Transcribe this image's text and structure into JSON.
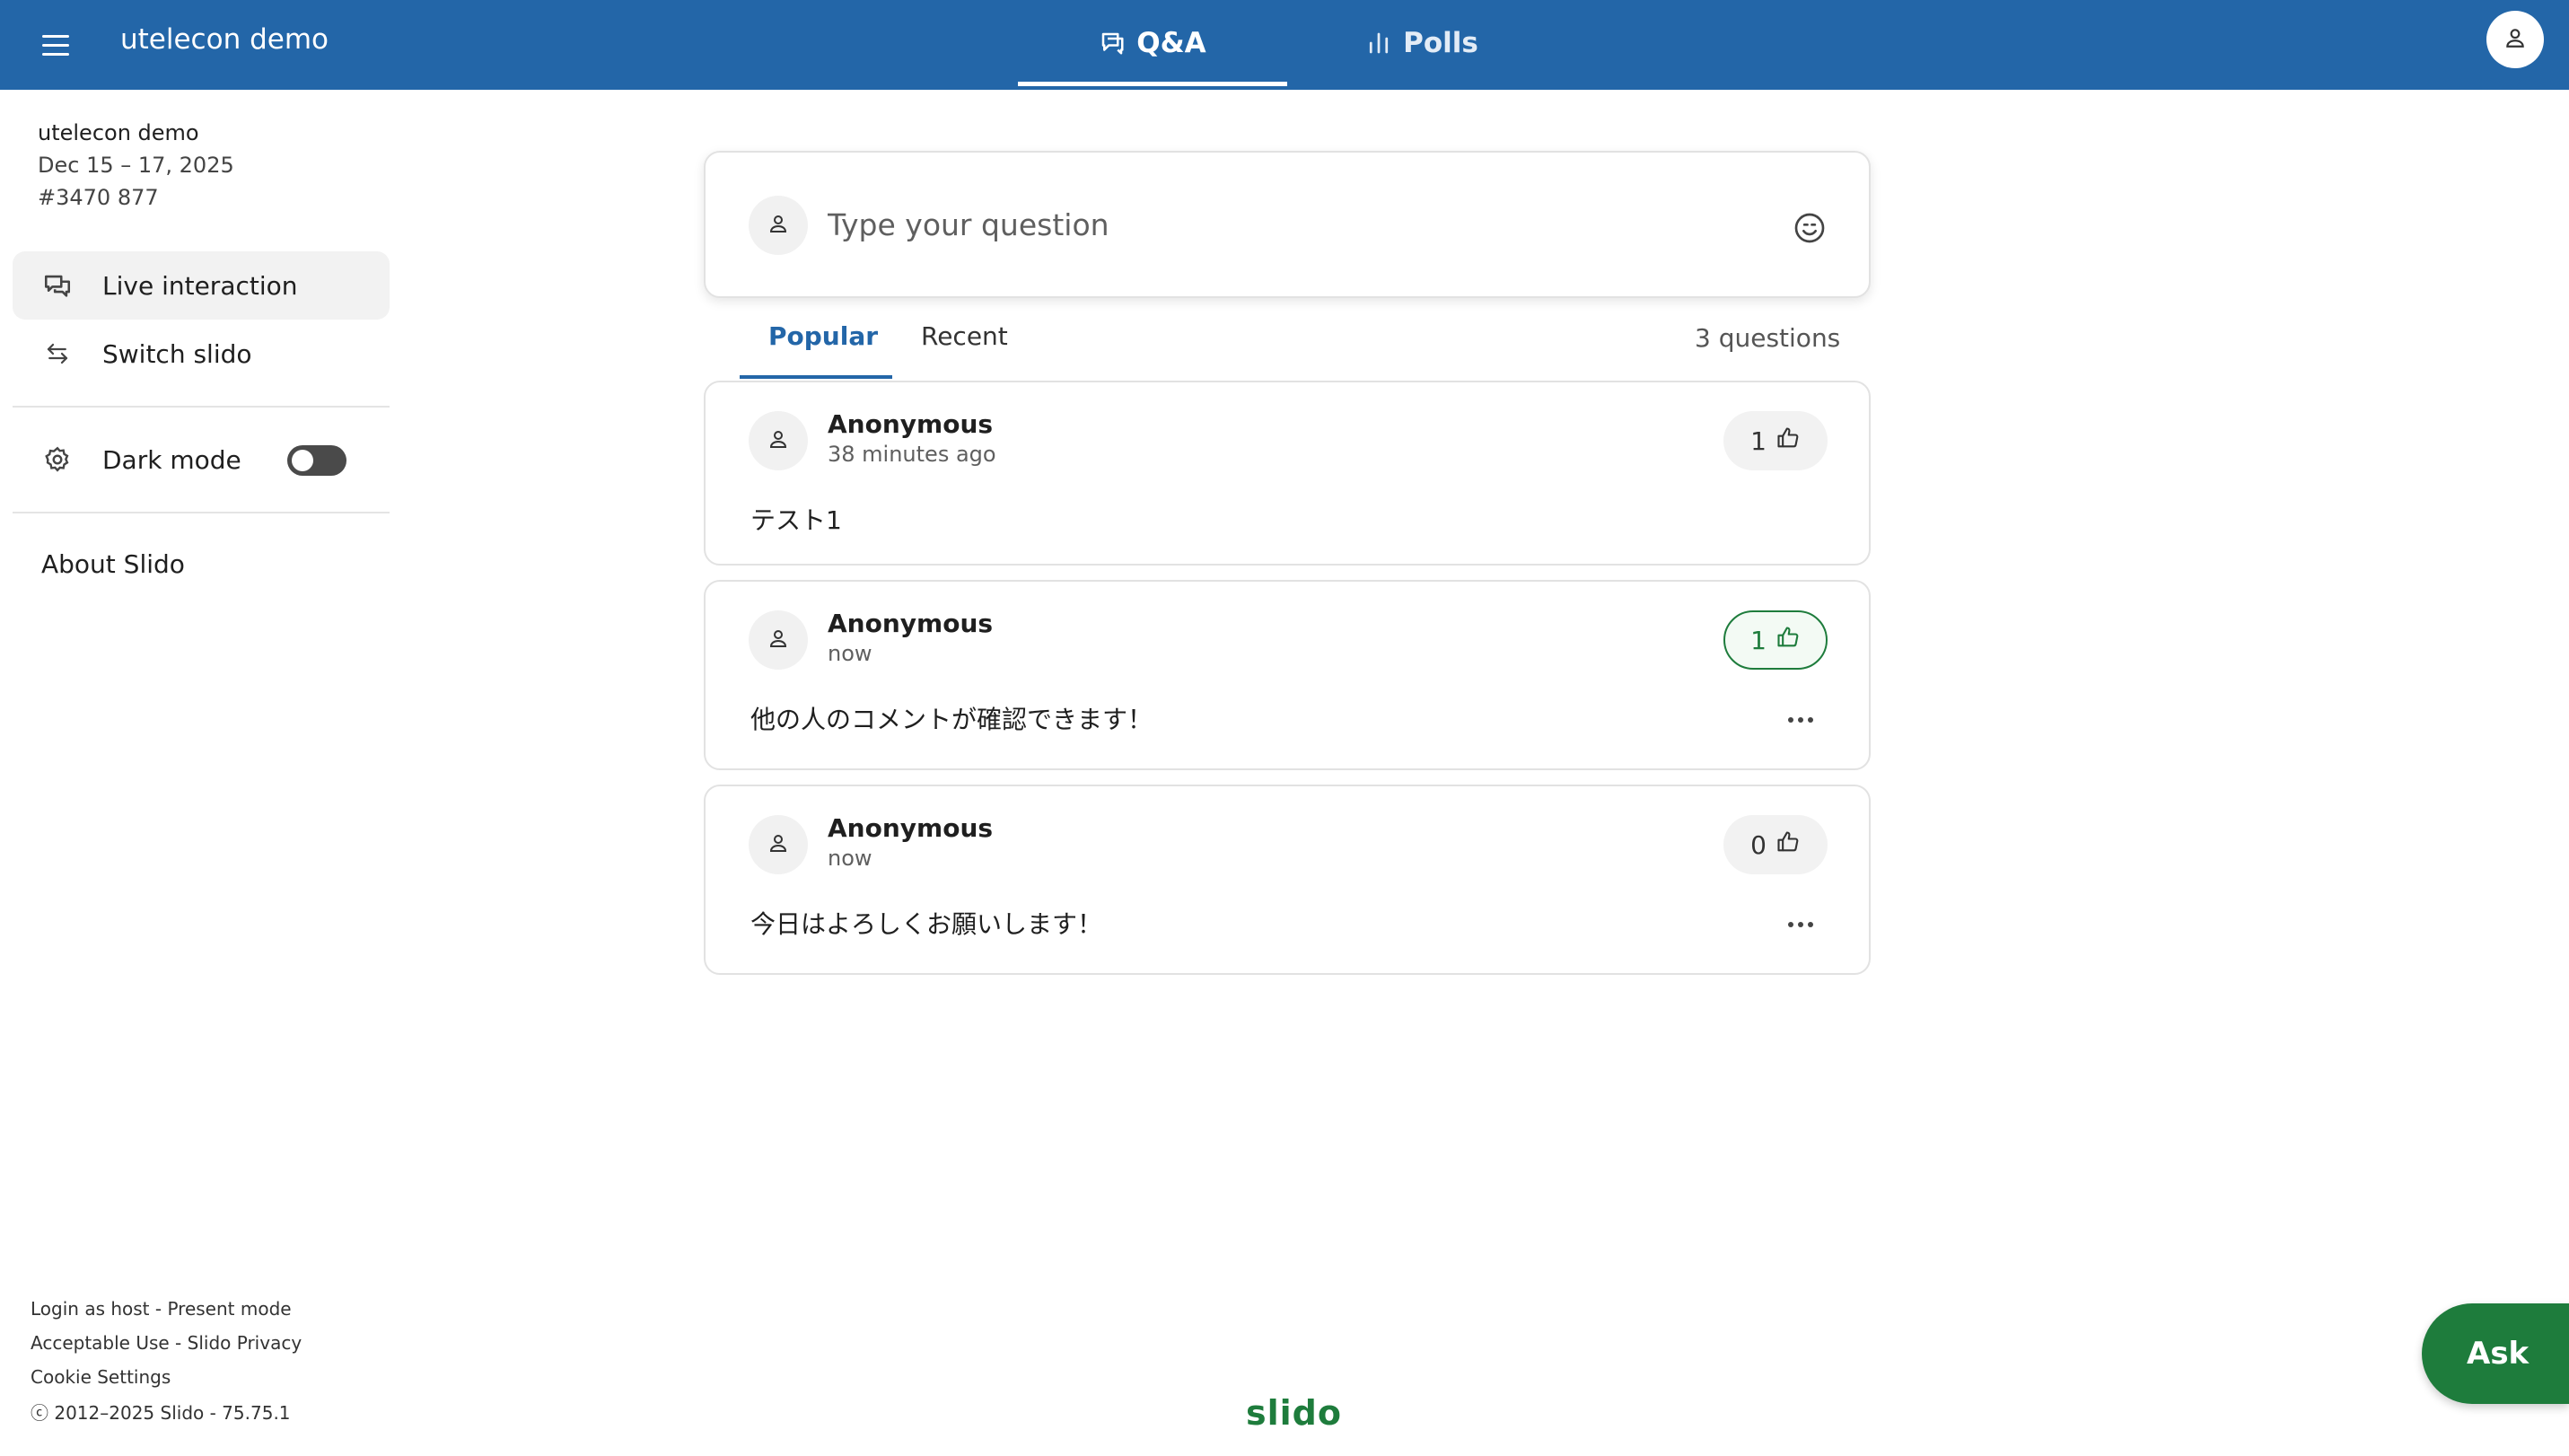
{
  "header": {
    "title": "utelecon demo",
    "tabs": [
      {
        "label": "Q&A",
        "icon": "chat-bubble-icon",
        "active": true
      },
      {
        "label": "Polls",
        "icon": "bar-chart-icon",
        "active": false
      }
    ],
    "user_icon": "user-icon"
  },
  "sidebar": {
    "event_name": "utelecon demo",
    "event_dates": "Dec 15 – 17, 2025",
    "event_code": "#3470 877",
    "items": [
      {
        "label": "Live interaction",
        "icon": "chat-bubbles-icon",
        "active": true
      },
      {
        "label": "Switch slido",
        "icon": "swap-arrows-icon",
        "active": false
      }
    ],
    "dark_mode": {
      "label": "Dark mode",
      "icon": "gear-icon",
      "enabled": false
    },
    "about": "About Slido",
    "footer": {
      "login_host": "Login as host",
      "sep1": " - ",
      "present_mode": "Present mode",
      "acceptable_use": "Acceptable Use",
      "sep2": " - ",
      "privacy": "Slido Privacy",
      "cookie": "Cookie Settings",
      "copyright": "ⓒ 2012–2025 Slido - 75.75.1"
    }
  },
  "ask": {
    "placeholder": "Type your question",
    "emoji_icon": "smiley-icon"
  },
  "sort": {
    "popular": "Popular",
    "recent": "Recent",
    "count": "3 questions"
  },
  "questions": [
    {
      "author": "Anonymous",
      "time": "38 minutes ago",
      "text": "テスト1",
      "likes": "1",
      "liked": false
    },
    {
      "author": "Anonymous",
      "time": "now",
      "text": "他の人のコメントが確認できます！",
      "likes": "1",
      "liked": true
    },
    {
      "author": "Anonymous",
      "time": "now",
      "text": "今日はよろしくお願いします！",
      "likes": "0",
      "liked": false
    }
  ],
  "footer_brand": "slido",
  "fab": {
    "label": "Ask"
  },
  "colors": {
    "brand_blue": "#2366a8",
    "brand_green": "#1e7c3c"
  }
}
